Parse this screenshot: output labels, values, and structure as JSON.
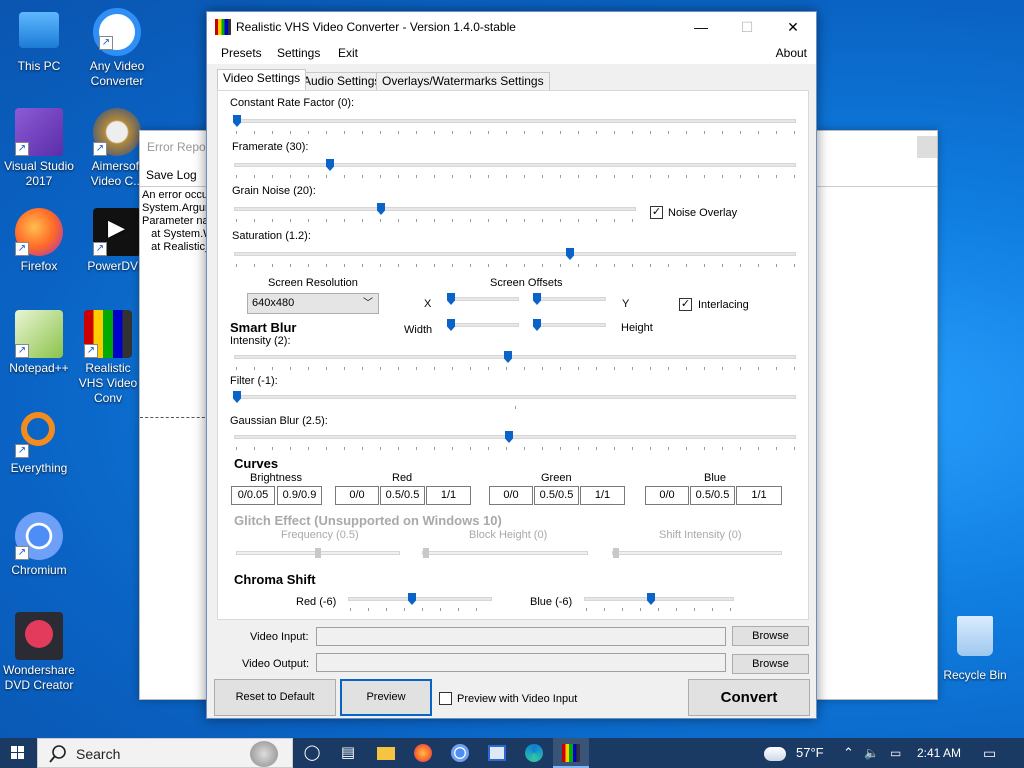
{
  "desktop": {
    "icons": [
      {
        "label": "This PC"
      },
      {
        "label": "Any Video Converter"
      },
      {
        "label": "Visual Studio 2017"
      },
      {
        "label": "Aimersoft Video C..."
      },
      {
        "label": "Firefox"
      },
      {
        "label": "PowerDVD"
      },
      {
        "label": "Notepad++"
      },
      {
        "label": "Realistic VHS Video Conv"
      },
      {
        "label": "Everything"
      },
      {
        "label": "Chromium"
      },
      {
        "label": "Wondershare DVD Creator"
      },
      {
        "label": "Recycle Bin"
      }
    ]
  },
  "error_window": {
    "title": "Error Repor",
    "save_log": "Save Log",
    "lines": [
      "An error occu",
      "",
      "System.Argum",
      "Parameter nar",
      "   at System.W",
      "   at Realistic_"
    ]
  },
  "window": {
    "title": "Realistic VHS Video Converter - Version 1.4.0-stable",
    "controls": {
      "minimize": "—",
      "maximize": "☐",
      "close": "✕"
    }
  },
  "menu": {
    "presets": "Presets",
    "settings": "Settings",
    "exit": "Exit",
    "about": "About"
  },
  "tabs": [
    "Video Settings",
    "Audio Settings",
    "Overlays/Watermarks Settings"
  ],
  "video": {
    "crf_label": "Constant Rate Factor (0):",
    "framerate_label": "Framerate (30):",
    "grain_label": "Grain Noise (20):",
    "noise_overlay_label": "Noise Overlay",
    "noise_overlay_checked": "✓",
    "saturation_label": "Saturation (1.2):",
    "screen_resolution_label": "Screen Resolution",
    "screen_resolution_value": "640x480",
    "screen_offsets_label": "Screen Offsets",
    "x_label": "X",
    "y_label": "Y",
    "width_label": "Width",
    "height_label": "Height",
    "interlacing_label": "Interlacing",
    "interlacing_checked": "✓",
    "smart_blur_header": "Smart Blur",
    "intensity_label": "Intensity (2):",
    "filter_label": "Filter (-1):",
    "gaussian_label": "Gaussian Blur (2.5):",
    "curves_header": "Curves",
    "curves": {
      "brightness": {
        "label": "Brightness",
        "values": [
          "0/0.05",
          "0.9/0.9"
        ]
      },
      "red": {
        "label": "Red",
        "values": [
          "0/0",
          "0.5/0.5",
          "1/1"
        ]
      },
      "green": {
        "label": "Green",
        "values": [
          "0/0",
          "0.5/0.5",
          "1/1"
        ]
      },
      "blue": {
        "label": "Blue",
        "values": [
          "0/0",
          "0.5/0.5",
          "1/1"
        ]
      }
    },
    "glitch_header": "Glitch Effect (Unsupported on Windows 10)",
    "frequency_label": "Frequency (0.5)",
    "block_height_label": "Block Height (0)",
    "shift_intensity_label": "Shift Intensity (0)",
    "chroma_header": "Chroma Shift",
    "chroma_red_label": "Red (-6)",
    "chroma_blue_label": "Blue (-6)"
  },
  "io": {
    "video_input_label": "Video Input:",
    "video_output_label": "Video Output:",
    "browse": "Browse"
  },
  "footer": {
    "reset": "Reset to Default",
    "preview": "Preview",
    "preview_with_input": "Preview with Video Input",
    "convert": "Convert"
  },
  "taskbar": {
    "search_placeholder": "Search",
    "weather": "57°F",
    "time": "2:41 AM",
    "start_icon": "windows-logo"
  },
  "colors": {
    "accent": "#0a64c8",
    "desktop": "#0f7ee0",
    "taskbar": "#1a3a63"
  }
}
